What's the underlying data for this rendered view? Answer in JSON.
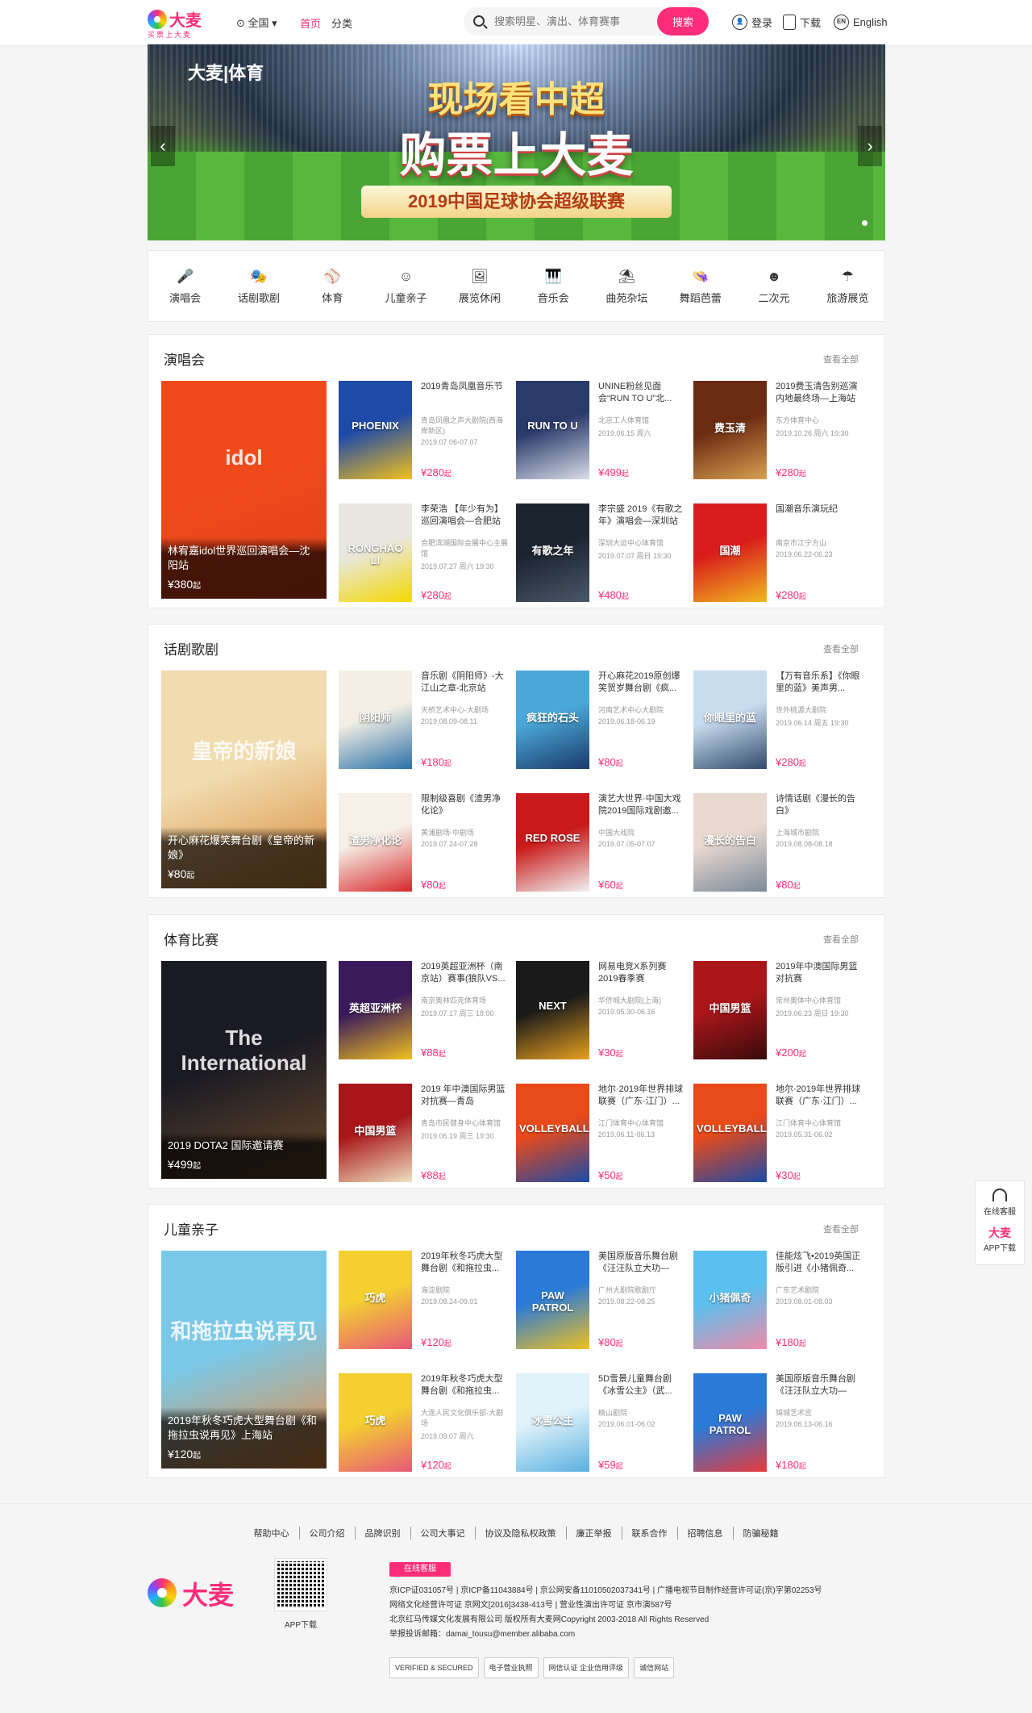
{
  "header": {
    "logo_name": "大麦",
    "logo_sub": "买票上大麦",
    "city": "全国",
    "nav": [
      "首页",
      "分类"
    ],
    "search_placeholder": "搜索明星、演出、体育赛事",
    "search_button": "搜索",
    "login": "登录",
    "download": "下载",
    "en_icon": "EN",
    "english": "English"
  },
  "banner": {
    "brand": "大麦|体育",
    "line1": "现场看中超",
    "line2": "购票上大麦",
    "line3": "2019中国足球协会超级联赛",
    "prev": "‹",
    "next": "›"
  },
  "categories": [
    {
      "label": "演唱会",
      "icon": "mic-icon",
      "glyph": "🎤"
    },
    {
      "label": "话剧歌剧",
      "icon": "mask-icon",
      "glyph": "🎭"
    },
    {
      "label": "体育",
      "icon": "ball-icon",
      "glyph": "⚾"
    },
    {
      "label": "儿童亲子",
      "icon": "child-icon",
      "glyph": "☺"
    },
    {
      "label": "展览休闲",
      "icon": "picture-icon",
      "glyph": "🖼"
    },
    {
      "label": "音乐会",
      "icon": "piano-icon",
      "glyph": "🎹"
    },
    {
      "label": "曲苑杂坛",
      "icon": "fan-icon",
      "glyph": "⛱"
    },
    {
      "label": "舞蹈芭蕾",
      "icon": "dance-icon",
      "glyph": "👒"
    },
    {
      "label": "二次元",
      "icon": "anime-icon",
      "glyph": "☻"
    },
    {
      "label": "旅游展览",
      "icon": "umbrella-icon",
      "glyph": "☂"
    }
  ],
  "more_label": "查看全部",
  "sections": [
    {
      "title": "演唱会",
      "featured": {
        "title": "林宥嘉idol世界巡回演唱会—沈阳站",
        "price": "¥380",
        "unit": "起",
        "poster_text": "idol",
        "colors": [
          "#f04a1c",
          "#e0401a"
        ]
      },
      "items": [
        {
          "title": "2019青岛凤凰音乐节",
          "venue": "青岛凤凰之声大剧院(西海岸新区)",
          "date": "2019.07.06-07.07",
          "price": "¥280",
          "unit": "起",
          "poster_text": "PHOENIX",
          "colors": [
            "#1e4aa8",
            "#f3c01c"
          ]
        },
        {
          "title": "UNINE粉丝见面会“RUN TO U”北...",
          "venue": "北京工人体育馆",
          "date": "2019.06.15 周六",
          "price": "¥499",
          "unit": "起",
          "poster_text": "RUN TO U",
          "colors": [
            "#2a3a6a",
            "#d8dde8"
          ]
        },
        {
          "title": "2019费玉清告别巡演内地最终场—上海站",
          "venue": "东方体育中心",
          "date": "2019.10.26 周六 19:30",
          "price": "¥280",
          "unit": "起",
          "poster_text": "费玉清",
          "colors": [
            "#6b2a12",
            "#d8a050"
          ]
        },
        {
          "title": "李荣浩 【年少有为】巡回演唱会—合肥站",
          "venue": "合肥滨湖国际会展中心主展馆",
          "date": "2019.07.27 周六 19:30",
          "price": "¥280",
          "unit": "起",
          "poster_text": "RONGHAO LI",
          "colors": [
            "#e8e8e0",
            "#f5d800"
          ]
        },
        {
          "title": "李宗盛 2019《有歌之年》演唱会—深圳站",
          "venue": "深圳大运中心体育馆",
          "date": "2019.07.07 周日 19:30",
          "price": "¥480",
          "unit": "起",
          "poster_text": "有歌之年",
          "colors": [
            "#1c2430",
            "#4a5868"
          ]
        },
        {
          "title": "国潮音乐演玩纪",
          "venue": "南京市江宁方山",
          "date": "2019.06.22-06.23",
          "price": "¥280",
          "unit": "起",
          "poster_text": "国潮",
          "colors": [
            "#d81c1c",
            "#f2b820"
          ]
        }
      ]
    },
    {
      "title": "话剧歌剧",
      "featured": {
        "title": "开心麻花爆笑舞台剧《皇帝的新娘》",
        "price": "¥80",
        "unit": "起",
        "poster_text": "皇帝的新娘",
        "colors": [
          "#f1dcb0",
          "#d98a3a"
        ]
      },
      "items": [
        {
          "title": "音乐剧《阴阳师》-大江山之章-北京站",
          "venue": "天桥艺术中心-大剧场",
          "date": "2019.08.09-08.11",
          "price": "¥180",
          "unit": "起",
          "poster_text": "阴阳师",
          "colors": [
            "#f3efe4",
            "#2a6fa8"
          ]
        },
        {
          "title": "开心麻花2019原创爆笑贺岁舞台剧《疯...",
          "venue": "河南艺术中心大剧院",
          "date": "2019.06.18-06.19",
          "price": "¥80",
          "unit": "起",
          "poster_text": "疯狂的石头",
          "colors": [
            "#4aa8d8",
            "#1a3a6a"
          ]
        },
        {
          "title": "【万有音乐系】《你眼里的蓝》美声男...",
          "venue": "世外桃源大剧院",
          "date": "2019.06.14 周五 19:30",
          "price": "¥280",
          "unit": "起",
          "poster_text": "你眼里的蓝",
          "colors": [
            "#c8dcf0",
            "#304a6a"
          ]
        },
        {
          "title": "限制级喜剧《渣男净化论》",
          "venue": "黄浦剧场-中剧场",
          "date": "2019.07.24-07.28",
          "price": "¥80",
          "unit": "起",
          "poster_text": "渣男净化论",
          "colors": [
            "#f5f0e8",
            "#d8282a"
          ]
        },
        {
          "title": "演艺大世界·中国大戏院2019国际戏剧邀...",
          "venue": "中国大戏院",
          "date": "2019.07.05-07.07",
          "price": "¥60",
          "unit": "起",
          "poster_text": "RED ROSE",
          "colors": [
            "#c81a1a",
            "#f2f2f2"
          ]
        },
        {
          "title": "诗情话剧《漫长的告白》",
          "venue": "上海城市剧院",
          "date": "2019.08.08-08.18",
          "price": "¥80",
          "unit": "起",
          "poster_text": "漫长的告白",
          "colors": [
            "#e8d8d0",
            "#7a8a9a"
          ]
        }
      ]
    },
    {
      "title": "体育比赛",
      "featured": {
        "title": "2019 DOTA2 国际邀请赛",
        "price": "¥499",
        "unit": "起",
        "poster_text": "The International",
        "colors": [
          "#1a1a24",
          "#6a4a2a"
        ]
      },
      "items": [
        {
          "title": "2019英超亚洲杯（南京站）赛事(狼队VS...",
          "venue": "南京奥林匹克体育场",
          "date": "2019.07.17 周三 18:00",
          "price": "¥88",
          "unit": "起",
          "poster_text": "英超亚洲杯",
          "colors": [
            "#3a1a5a",
            "#f0c020"
          ]
        },
        {
          "title": "网易电竞X系列赛2019春季赛",
          "venue": "华侨城大剧院(上海)",
          "date": "2019.05.30-06.16",
          "price": "¥30",
          "unit": "起",
          "poster_text": "NEXT",
          "colors": [
            "#1a1a1a",
            "#e8a020"
          ]
        },
        {
          "title": "2019年中澳国际男篮对抗赛",
          "venue": "常州奥体中心体育馆",
          "date": "2019.06.23 周日 19:30",
          "price": "¥200",
          "unit": "起",
          "poster_text": "中国男篮",
          "colors": [
            "#a8161a",
            "#3a0a0a"
          ]
        },
        {
          "title": "2019 年中澳国际男篮对抗赛—青岛",
          "venue": "青岛市民健身中心体育馆",
          "date": "2019.06.19 周三 19:30",
          "price": "¥88",
          "unit": "起",
          "poster_text": "中国男篮",
          "colors": [
            "#a8161a",
            "#f0e0c0"
          ]
        },
        {
          "title": "地尔·2019年世界排球联赛（广东·江门）...",
          "venue": "江门体育中心体育馆",
          "date": "2019.06.11-06.13",
          "price": "¥50",
          "unit": "起",
          "poster_text": "VOLLEYBALL",
          "colors": [
            "#e84a1a",
            "#1a4aa8"
          ]
        },
        {
          "title": "地尔·2019年世界排球联赛（广东·江门）...",
          "venue": "江门体育中心体育馆",
          "date": "2019.05.31-06.02",
          "price": "¥30",
          "unit": "起",
          "poster_text": "VOLLEYBALL",
          "colors": [
            "#e84a1a",
            "#1a4aa8"
          ]
        }
      ]
    },
    {
      "title": "儿童亲子",
      "featured": {
        "title": "2019年秋冬巧虎大型舞台剧《和拖拉虫说再见》上海站",
        "price": "¥120",
        "unit": "起",
        "poster_text": "和拖拉虫说再见",
        "colors": [
          "#7ac8e8",
          "#f08a3a"
        ]
      },
      "items": [
        {
          "title": "2019年秋冬巧虎大型舞台剧《和拖拉虫...",
          "venue": "海淀剧院",
          "date": "2019.08.24-09.01",
          "price": "¥120",
          "unit": "起",
          "poster_text": "巧虎",
          "colors": [
            "#f3d030",
            "#e8587a"
          ]
        },
        {
          "title": "美国原版音乐舞台剧《汪汪队立大功—救...",
          "venue": "广州大剧院歌剧厅",
          "date": "2019.08.22-08.25",
          "price": "¥80",
          "unit": "起",
          "poster_text": "PAW PATROL",
          "colors": [
            "#2a7ad8",
            "#f0c020"
          ]
        },
        {
          "title": "佳能炫飞•2019英国正版引进《小猪佩奇...",
          "venue": "广东艺术剧院",
          "date": "2019.08.01-08.03",
          "price": "¥180",
          "unit": "起",
          "poster_text": "小猪佩奇",
          "colors": [
            "#5ac0f0",
            "#f08aa8"
          ]
        },
        {
          "title": "2019年秋冬巧虎大型舞台剧《和拖拉虫...",
          "venue": "大连人民文化俱乐部-大剧场",
          "date": "2019.09.07 周六",
          "price": "¥120",
          "unit": "起",
          "poster_text": "巧虎",
          "colors": [
            "#f3d030",
            "#e8587a"
          ]
        },
        {
          "title": "5D雪景儿童舞台剧《冰雪公主》（武...",
          "venue": "楠山剧院",
          "date": "2019.06.01-06.02",
          "price": "¥59",
          "unit": "起",
          "poster_text": "冰雪公主",
          "colors": [
            "#dff2fa",
            "#5ab0e0"
          ]
        },
        {
          "title": "美国原版音乐舞台剧《汪汪队立大功—救...",
          "venue": "锦城艺术宫",
          "date": "2019.06.13-06.16",
          "price": "¥180",
          "unit": "起",
          "poster_text": "PAW PATROL",
          "colors": [
            "#2a7ad8",
            "#e83a3a"
          ]
        }
      ]
    }
  ],
  "side": {
    "service": "在线客服",
    "logo": "大麦",
    "app": "APP下载"
  },
  "footer": {
    "links": [
      "帮助中心",
      "公司介绍",
      "品牌识别",
      "公司大事记",
      "协议及隐私权政策",
      "廉正举报",
      "联系合作",
      "招聘信息",
      "防骗秘籍"
    ],
    "logo": "大麦",
    "app_download": "APP下载",
    "kefu": "在线客服",
    "lines": [
      "京ICP证031057号 | 京ICP备11043884号 | 京公网安备11010502037341号 | 广播电视节目制作经营许可证(京)字第02253号",
      "网络文化经营许可证 京网文[2016]3438-413号 | 营业性演出许可证 京市演587号",
      "北京红马传媒文化发展有限公司 版权所有大麦网Copyright 2003-2018 All Rights Reserved",
      "举报投诉邮箱：damai_tousu@member.alibaba.com"
    ],
    "badges": [
      "VERIFIED & SECURED",
      "电子营业执照",
      "网信认证 企业信用评级",
      "诚信网站"
    ]
  }
}
